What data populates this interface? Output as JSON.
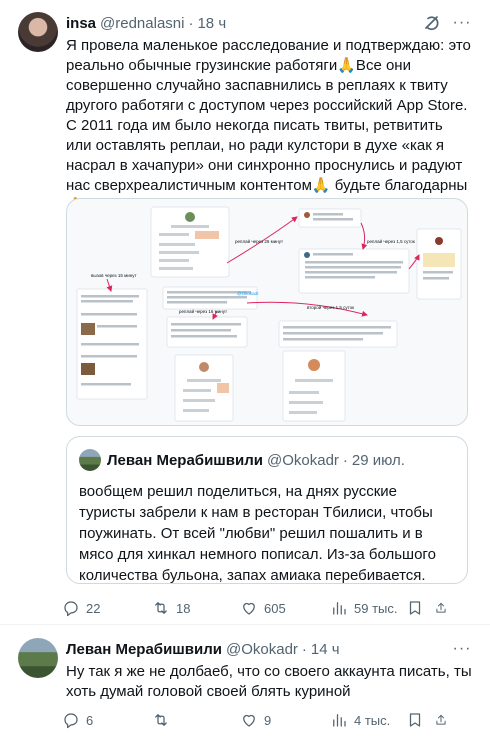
{
  "tweet1": {
    "author_name": "insa",
    "handle": "@rednalasni",
    "separator": "·",
    "time": "18 ч",
    "more_label": "···",
    "text": "Я провела маленькое расследование и подтверждаю: это реально обычные грузинские работяги🙏Все они совершенно случайно заспавнились в реплаях к твиту другого работяги с доступом через российский App Store. С 2011 года им было некогда писать твиты, ретвитить или оставлять реплаи, но ради кулстори в духе «как я насрал в хачапури» они синхронно проснулись и радуют нас сверхреалистичным контентом🙏 будьте благодарны 🙏",
    "media_labels": {
      "a1": "реплай через 26 минут",
      "a2": "реплай через 1,5 суток",
      "a3": "второй через 1,5 суток",
      "a4": "реплай через 16 минут",
      "a5": "вызов через 15 минут",
      "tag": "@Okokadr"
    },
    "quote": {
      "author_name": "Леван Мерабишвили",
      "handle": "@Okokadr",
      "separator": "·",
      "time": "29 июл.",
      "text": "вообщем решил поделиться, на днях русские туристы забрели к нам в ресторан Тбилиси, чтобы поужинать. От всей \"любви\" решил пошалить и в мясо для хинкал немного пописал. Из-за большого количества бульона, запах амиака перебивается. официант передал похвал…"
    },
    "stats": {
      "replies": "22",
      "retweets": "18",
      "likes": "605",
      "views": "59 тыс."
    }
  },
  "tweet2": {
    "author_name": "Леван Мерабишвили",
    "handle": "@Okokadr",
    "separator": "·",
    "time": "14 ч",
    "more_label": "···",
    "text": "Ну так я же не долбаеб, что со своего аккаунта писать, ты хоть думай головой своей блять куриной",
    "stats": {
      "replies": "6",
      "retweets": "",
      "likes": "9",
      "views": "4 тыс."
    }
  },
  "icons": [
    "grok-icon",
    "more-icon",
    "reply-icon",
    "retweet-icon",
    "like-icon",
    "views-icon",
    "bookmark-icon",
    "share-icon"
  ],
  "colors": {
    "text": "#0f1419",
    "secondary": "#536471",
    "border": "#cfd9de",
    "arrow": "#e0245e"
  }
}
